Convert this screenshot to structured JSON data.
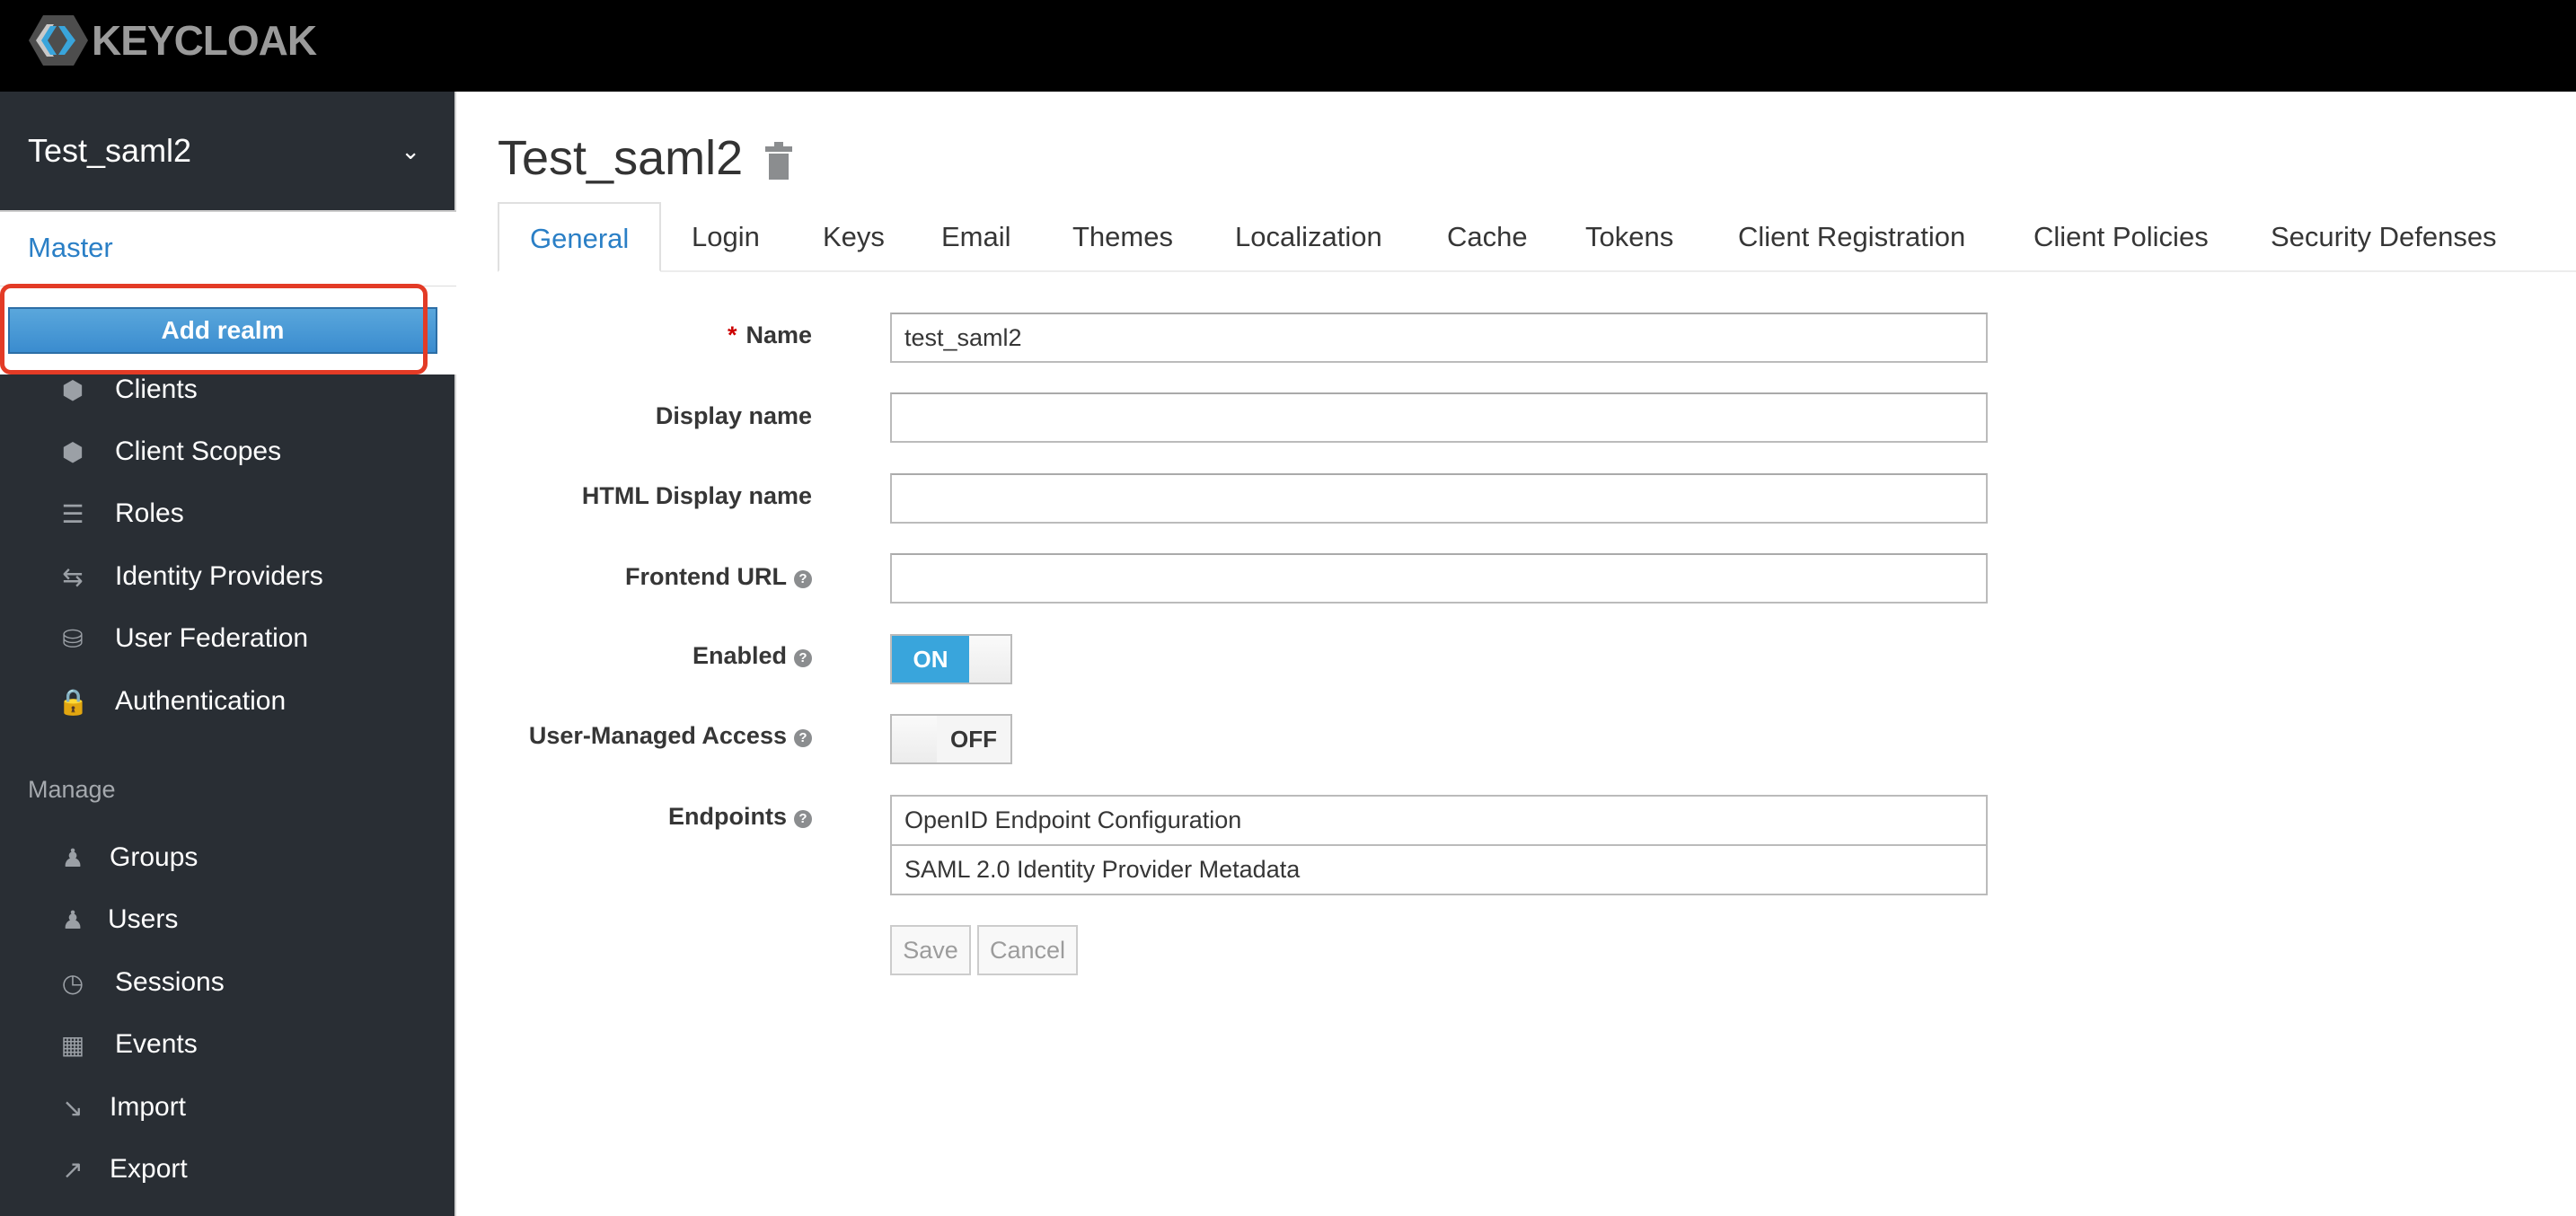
{
  "header": {
    "logo_text": "KEYCLOAK"
  },
  "sidebar": {
    "realm_selector": "Test_saml2",
    "realm_menu": {
      "master": "Master",
      "add_realm": "Add realm"
    },
    "configure_items": [
      {
        "label": "Clients",
        "icon": "cube-icon"
      },
      {
        "label": "Client Scopes",
        "icon": "cubes-icon"
      },
      {
        "label": "Roles",
        "icon": "roles-icon"
      },
      {
        "label": "Identity Providers",
        "icon": "exchange-icon"
      },
      {
        "label": "User Federation",
        "icon": "database-icon"
      },
      {
        "label": "Authentication",
        "icon": "lock-icon"
      }
    ],
    "manage_heading": "Manage",
    "manage_items": [
      {
        "label": "Groups",
        "icon": "users-icon"
      },
      {
        "label": "Users",
        "icon": "user-icon"
      },
      {
        "label": "Sessions",
        "icon": "clock-icon"
      },
      {
        "label": "Events",
        "icon": "calendar-icon"
      },
      {
        "label": "Import",
        "icon": "import-icon"
      },
      {
        "label": "Export",
        "icon": "export-icon"
      }
    ]
  },
  "main": {
    "title": "Test_saml2",
    "tabs": [
      "General",
      "Login",
      "Keys",
      "Email",
      "Themes",
      "Localization",
      "Cache",
      "Tokens",
      "Client Registration",
      "Client Policies",
      "Security Defenses"
    ],
    "active_tab": "General",
    "form": {
      "name_label": "Name",
      "name_value": "test_saml2",
      "required_mark": "*",
      "display_name_label": "Display name",
      "display_name_value": "",
      "html_display_name_label": "HTML Display name",
      "html_display_name_value": "",
      "frontend_url_label": "Frontend URL",
      "frontend_url_value": "",
      "enabled_label": "Enabled",
      "enabled_state": "ON",
      "uma_label": "User-Managed Access",
      "uma_state": "OFF",
      "endpoints_label": "Endpoints",
      "endpoints": [
        "OpenID Endpoint Configuration",
        "SAML 2.0 Identity Provider Metadata"
      ],
      "save": "Save",
      "cancel": "Cancel"
    }
  },
  "colors": {
    "accent": "#2a7fc6",
    "sidebar": "#292e34",
    "toggle_on": "#39a5dc",
    "highlight": "#e33b26"
  }
}
